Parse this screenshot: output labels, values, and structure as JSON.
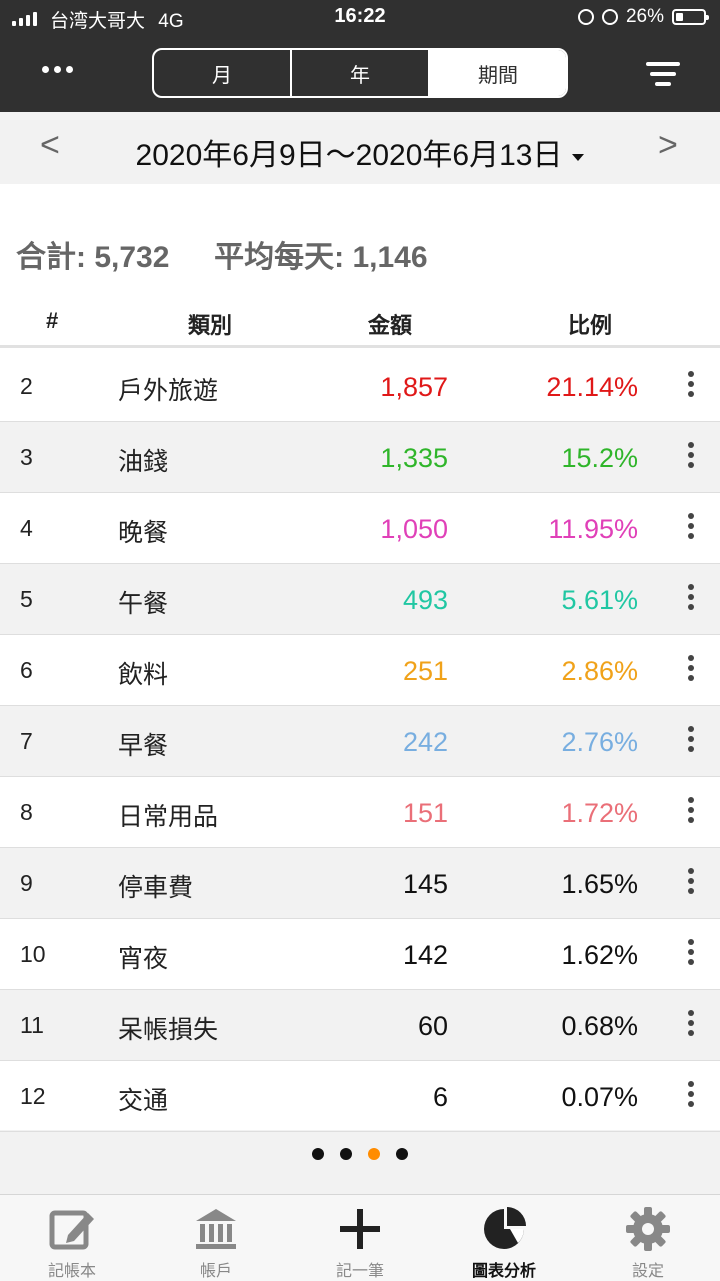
{
  "status_bar": {
    "carrier": "台湾大哥大",
    "network": "4G",
    "time": "16:22",
    "battery": "26%"
  },
  "header": {
    "segments": [
      {
        "label": "月",
        "active": false
      },
      {
        "label": "年",
        "active": false
      },
      {
        "label": "期間",
        "active": true
      }
    ],
    "menu_icon": "more-dots-icon",
    "filter_icon": "filter-icon"
  },
  "date_bar": {
    "prev": "<",
    "next": ">",
    "range": "2020年6月9日～2020年6月13日"
  },
  "summary": {
    "total_label": "合計:",
    "total_value": "5,732",
    "avg_label": "平均每天:",
    "avg_value": "1,146"
  },
  "table": {
    "columns": {
      "rank": "#",
      "category": "類別",
      "amount": "金額",
      "ratio": "比例"
    },
    "rows": [
      {
        "rank": "2",
        "category": "戶外旅遊",
        "amount": "1,857",
        "ratio": "21.14%",
        "color": "#e01818"
      },
      {
        "rank": "3",
        "category": "油錢",
        "amount": "1,335",
        "ratio": "15.2%",
        "color": "#2fb52a"
      },
      {
        "rank": "4",
        "category": "晚餐",
        "amount": "1,050",
        "ratio": "11.95%",
        "color": "#e040b8"
      },
      {
        "rank": "5",
        "category": "午餐",
        "amount": "493",
        "ratio": "5.61%",
        "color": "#21c7a3"
      },
      {
        "rank": "6",
        "category": "飲料",
        "amount": "251",
        "ratio": "2.86%",
        "color": "#f0a21a"
      },
      {
        "rank": "7",
        "category": "早餐",
        "amount": "242",
        "ratio": "2.76%",
        "color": "#78aee0"
      },
      {
        "rank": "8",
        "category": "日常用品",
        "amount": "151",
        "ratio": "1.72%",
        "color": "#ea6f78"
      },
      {
        "rank": "9",
        "category": "停車費",
        "amount": "145",
        "ratio": "1.65%",
        "color": "#111111"
      },
      {
        "rank": "10",
        "category": "宵夜",
        "amount": "142",
        "ratio": "1.62%",
        "color": "#111111"
      },
      {
        "rank": "11",
        "category": "呆帳損失",
        "amount": "60",
        "ratio": "0.68%",
        "color": "#111111"
      },
      {
        "rank": "12",
        "category": "交通",
        "amount": "6",
        "ratio": "0.07%",
        "color": "#111111"
      }
    ]
  },
  "pager": {
    "count": 4,
    "active_index": 2,
    "active_color": "#ff8c00"
  },
  "tab_bar": [
    {
      "label": "記帳本",
      "icon": "edit-book-icon",
      "active": false
    },
    {
      "label": "帳戶",
      "icon": "bank-icon",
      "active": false
    },
    {
      "label": "記一筆",
      "icon": "plus-icon",
      "active": false
    },
    {
      "label": "圖表分析",
      "icon": "pie-chart-icon",
      "active": true
    },
    {
      "label": "設定",
      "icon": "gear-icon",
      "active": false
    }
  ]
}
